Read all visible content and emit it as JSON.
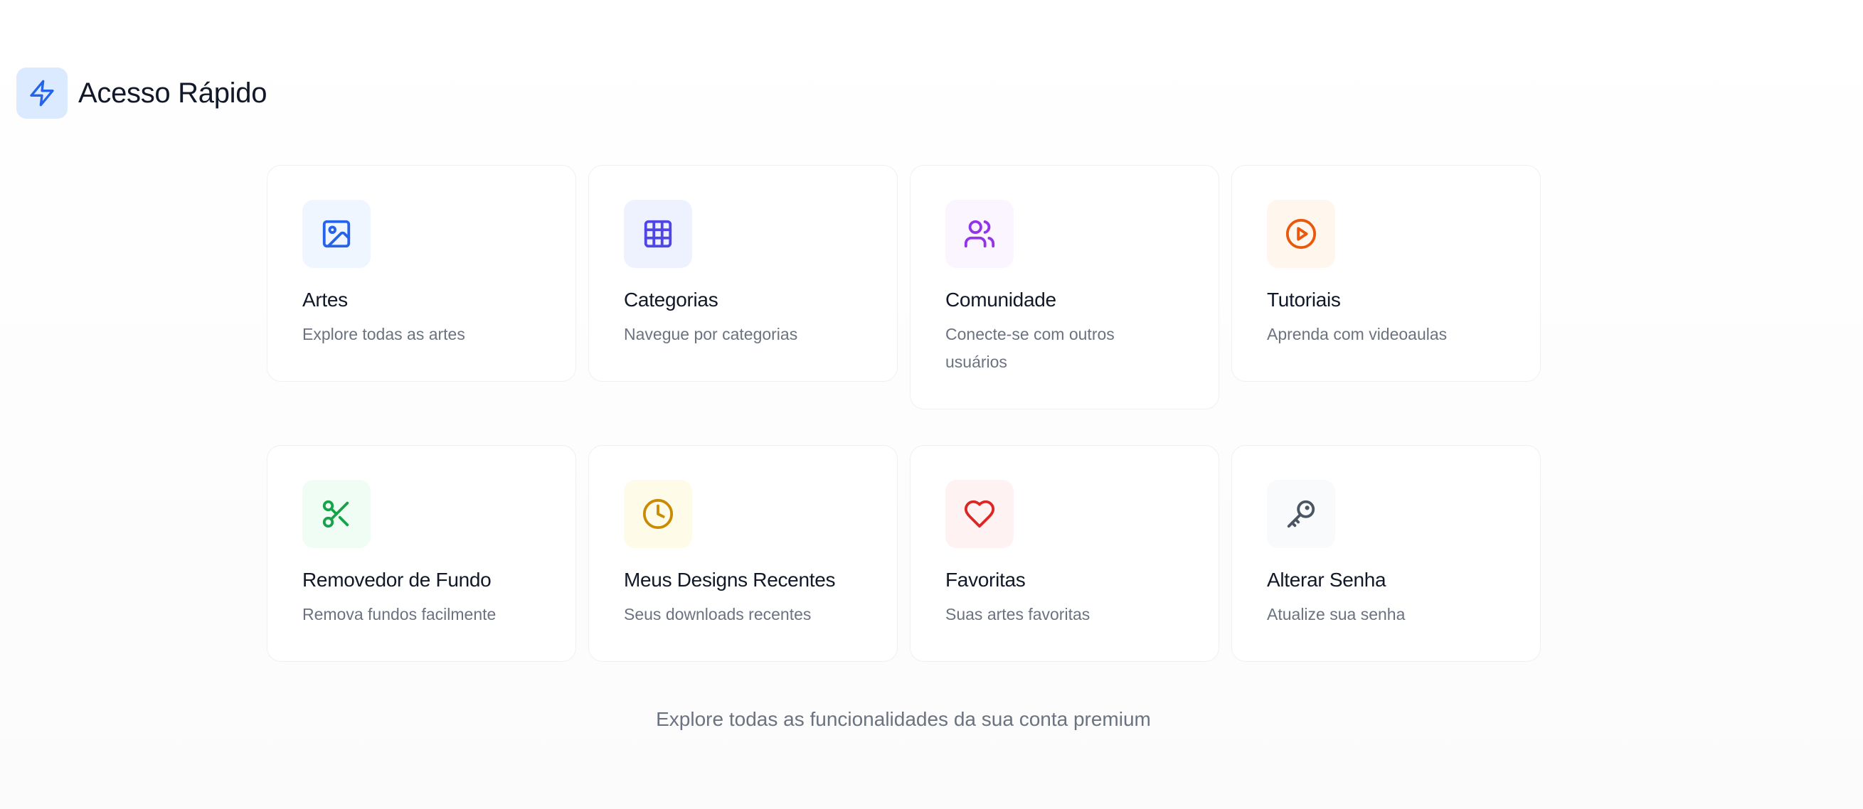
{
  "header": {
    "title": "Acesso Rápido",
    "icon": "lightning-bolt-icon",
    "icon_color": "#2563eb",
    "icon_bg": "#dbeafe"
  },
  "cards": [
    {
      "title": "Artes",
      "description": "Explore todas as artes",
      "icon": "image-icon",
      "icon_color": "#2563eb",
      "icon_bg": "#eff6ff"
    },
    {
      "title": "Categorias",
      "description": "Navegue por categorias",
      "icon": "grid-icon",
      "icon_color": "#4f46e5",
      "icon_bg": "#eef2ff"
    },
    {
      "title": "Comunidade",
      "description": "Conecte-se com outros usuários",
      "icon": "users-icon",
      "icon_color": "#9333ea",
      "icon_bg": "#faf5ff"
    },
    {
      "title": "Tutoriais",
      "description": "Aprenda com videoaulas",
      "icon": "play-circle-icon",
      "icon_color": "#ea580c",
      "icon_bg": "#fff7ed"
    },
    {
      "title": "Removedor de Fundo",
      "description": "Remova fundos facilmente",
      "icon": "scissors-icon",
      "icon_color": "#16a34a",
      "icon_bg": "#f0fdf4"
    },
    {
      "title": "Meus Designs Recentes",
      "description": "Seus downloads recentes",
      "icon": "clock-icon",
      "icon_color": "#ca8a04",
      "icon_bg": "#fefce8"
    },
    {
      "title": "Favoritas",
      "description": "Suas artes favoritas",
      "icon": "heart-icon",
      "icon_color": "#dc2626",
      "icon_bg": "#fef2f2"
    },
    {
      "title": "Alterar Senha",
      "description": "Atualize sua senha",
      "icon": "key-icon",
      "icon_color": "#4b5563",
      "icon_bg": "#f9fafb"
    }
  ],
  "footer": {
    "text": "Explore todas as funcionalidades da sua conta premium"
  }
}
